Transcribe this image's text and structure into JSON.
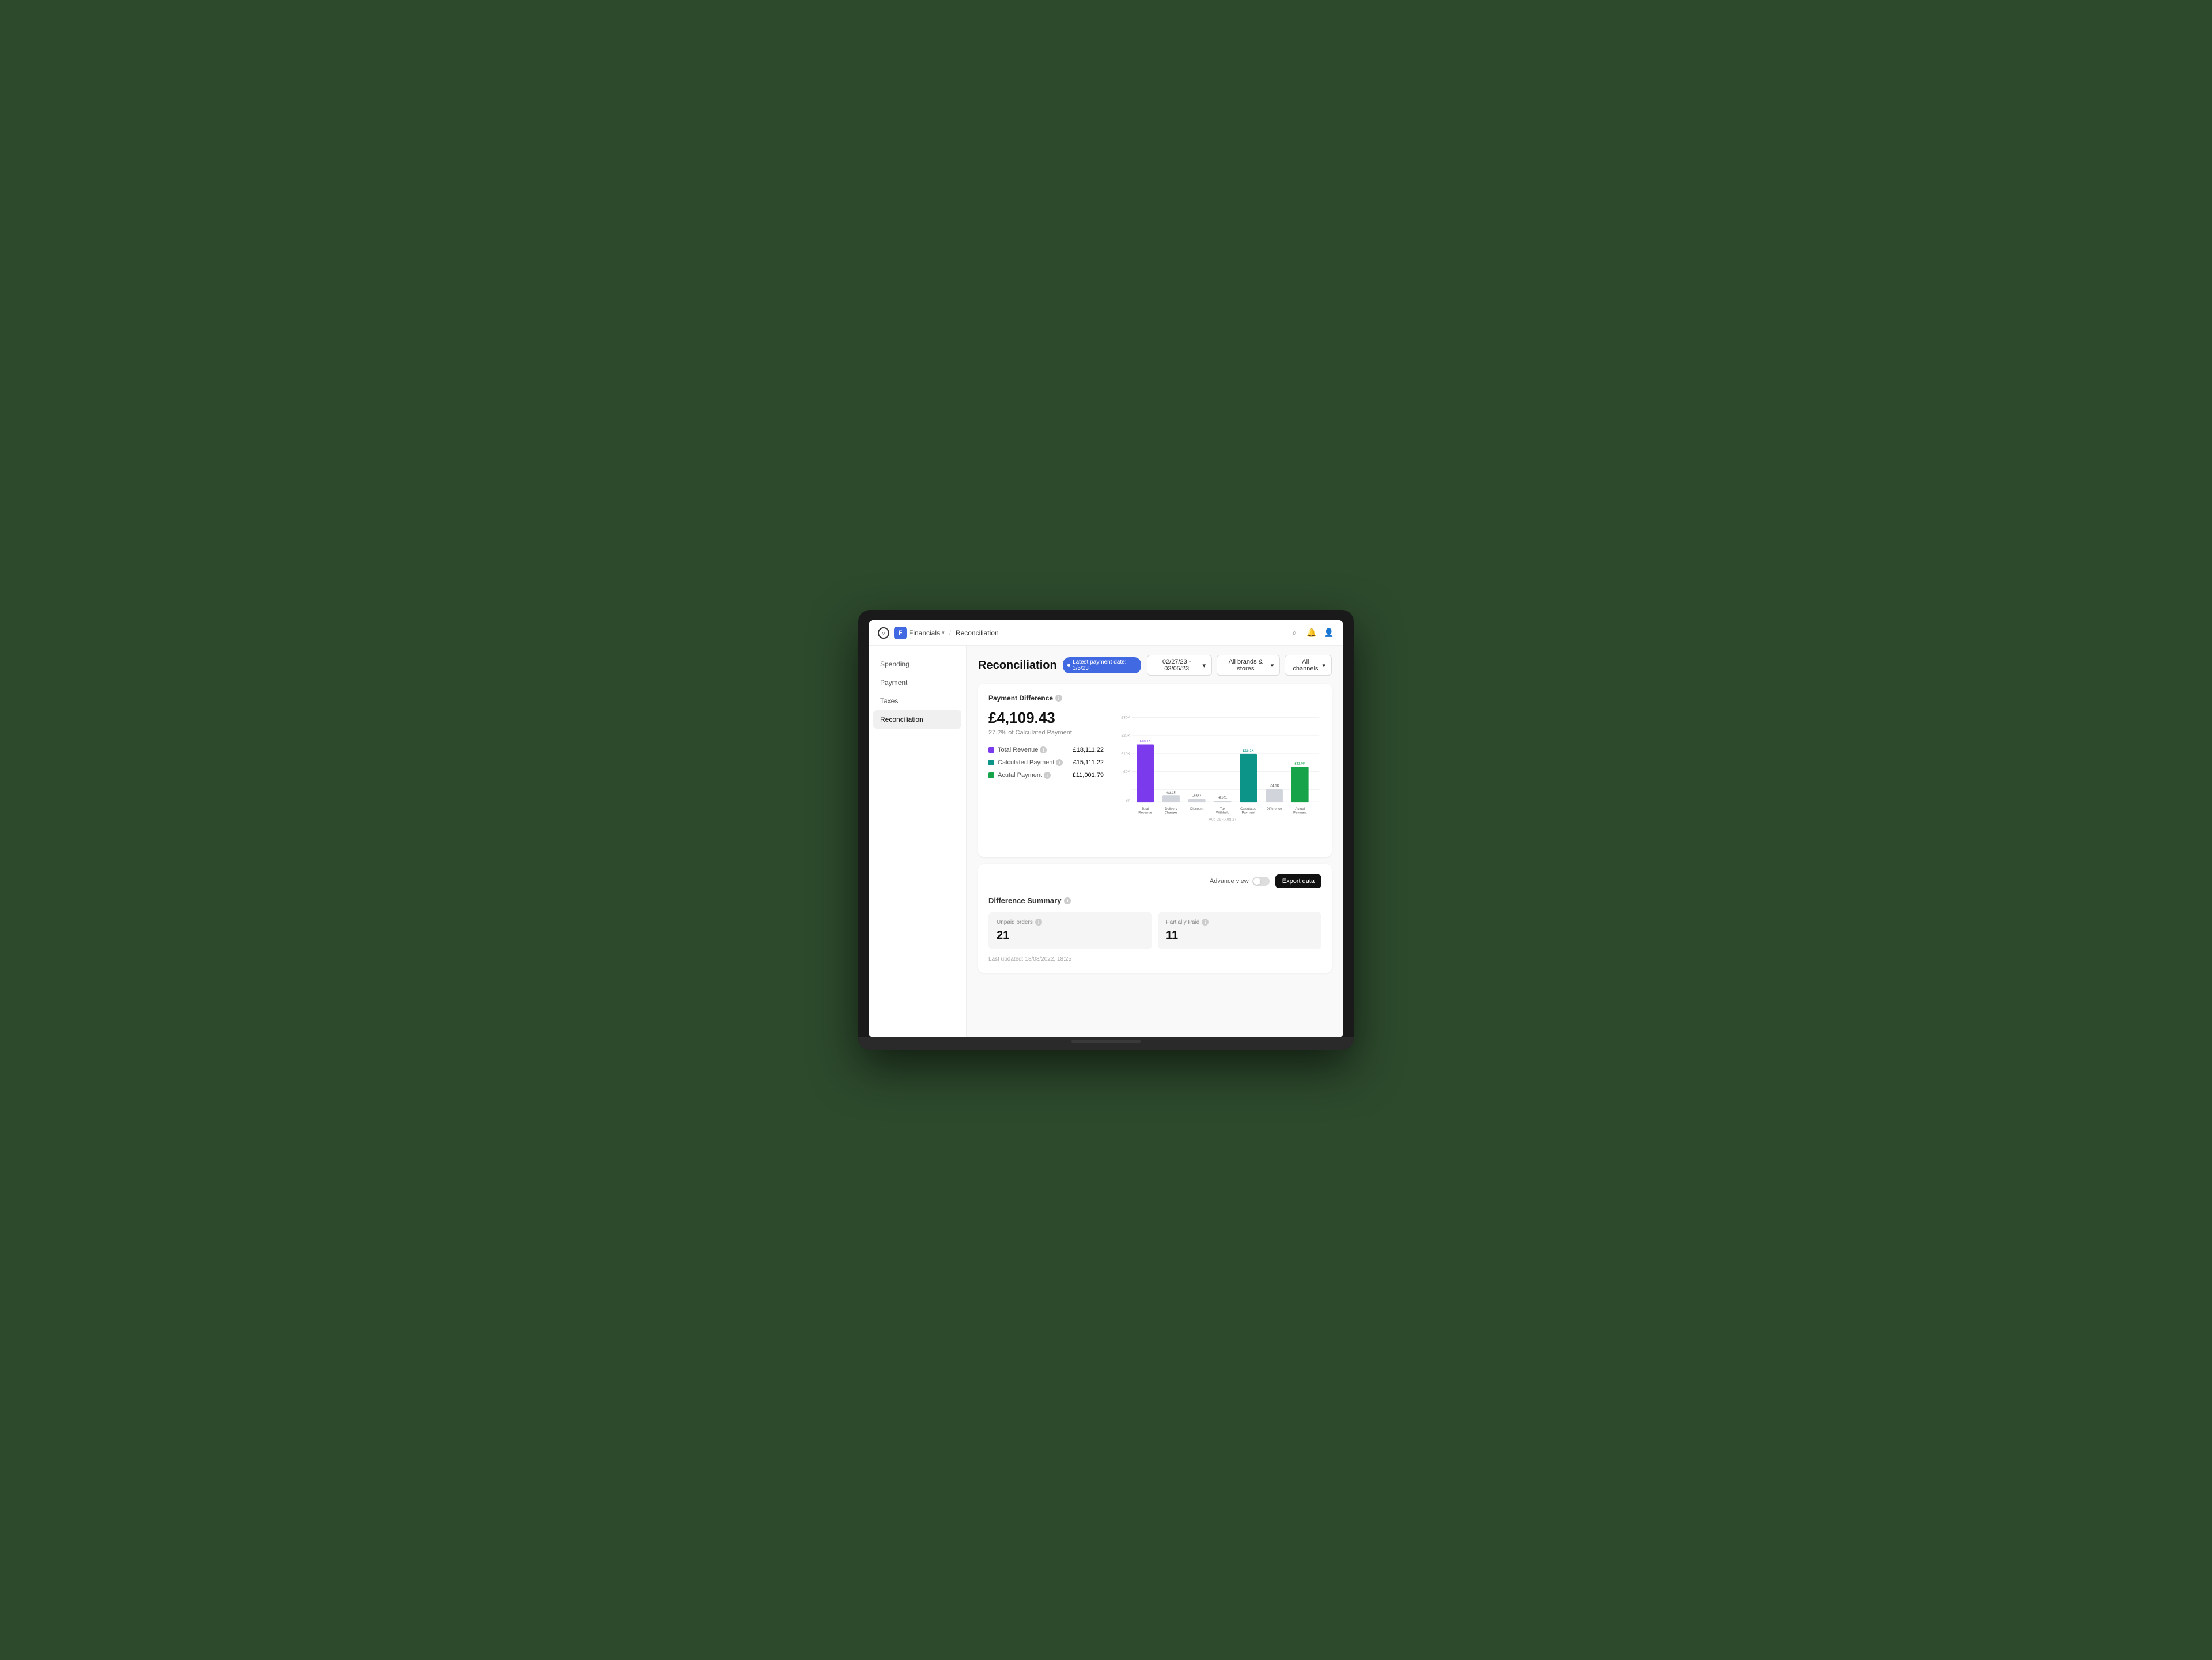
{
  "topbar": {
    "logo_label": "○",
    "app_icon_label": "F",
    "financials_label": "Financials",
    "chevron": "∨",
    "separator": "/",
    "page_label": "Reconciliation",
    "search_icon": "⌕",
    "bell_icon": "🔔",
    "user_icon": "👤"
  },
  "sidebar": {
    "items": [
      {
        "label": "Spending",
        "active": false
      },
      {
        "label": "Payment",
        "active": false
      },
      {
        "label": "Taxes",
        "active": false
      },
      {
        "label": "Reconciliation",
        "active": true
      }
    ]
  },
  "page": {
    "title": "Reconciliation",
    "payment_badge": "Latest payment date: 3/5/23",
    "filters": {
      "date_range": "02/27/23 - 03/05/23",
      "brands_stores": "All brands & stores",
      "channels": "All channels"
    }
  },
  "payment_difference": {
    "section_title": "Payment Difference",
    "amount": "£4,109.43",
    "pct_value": "27.2%",
    "pct_label": "of Calculated Payment",
    "metrics": [
      {
        "label": "Total Revenue",
        "value": "£18,111.22",
        "color": "#7c3aed"
      },
      {
        "label": "Calculated Payment",
        "value": "£15,111.22",
        "color": "#0d9488"
      },
      {
        "label": "Acutal Payment",
        "value": "£11,001.79",
        "color": "#16a34a"
      }
    ]
  },
  "chart": {
    "y_labels": [
      "£30K",
      "£20K",
      "£10K",
      "£5K",
      "£0"
    ],
    "x_labels": [
      "Total Revenue",
      "Delivery Charges",
      "Discount",
      "Tax Withheld",
      "Calculated Payment",
      "Difference",
      "Actual Payment"
    ],
    "date_range": "Aug 21 - Aug 27",
    "bars": [
      {
        "label": "Total Revenue",
        "value": 18100,
        "top_label": "£18.1K",
        "color": "#7c3aed"
      },
      {
        "label": "Delivery Charges",
        "value": 2100,
        "top_label": "-£2.1K",
        "color": "#d1d5db"
      },
      {
        "label": "Discount",
        "value": 562,
        "top_label": "-£562",
        "color": "#d1d5db"
      },
      {
        "label": "Tax Withheld",
        "value": 101,
        "top_label": "-£101",
        "color": "#d1d5db"
      },
      {
        "label": "Calculated Payment",
        "value": 15100,
        "top_label": "£15.1K",
        "color": "#0d9488"
      },
      {
        "label": "Difference",
        "value": 4100,
        "top_label": "-£4.1K",
        "color": "#d1d5db"
      },
      {
        "label": "Actual Payment",
        "value": 11000,
        "top_label": "£11.0K",
        "color": "#16a34a"
      }
    ]
  },
  "difference_summary": {
    "section_title": "Difference Summary",
    "advance_view_label": "Advance view",
    "export_btn_label": "Export data",
    "cards": [
      {
        "label": "Unpaid orders",
        "value": "21"
      },
      {
        "label": "Partially Paid",
        "value": "11"
      }
    ],
    "last_updated": "Last updated: 18/08/2022, 18:25"
  }
}
